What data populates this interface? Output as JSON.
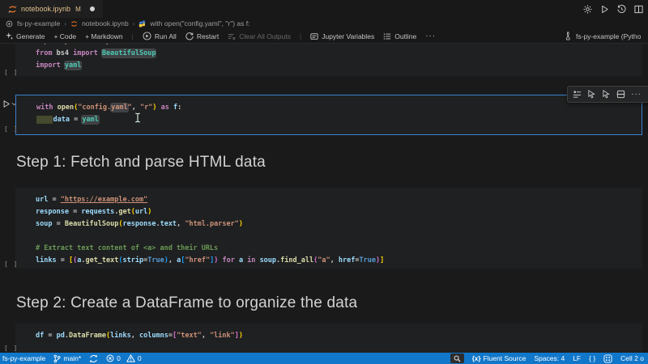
{
  "colors": {
    "status_bar": "#1177ca",
    "focus_border": "#3b82d0",
    "cell_background": "#1f2021",
    "editor_background": "#1a1a1a",
    "chrome_background": "#181818",
    "modified_tab": "#e2c08d",
    "jupyter_orange": "#f37626",
    "keyword": "#c586c0",
    "function": "#dcdcaa",
    "string": "#ce9178",
    "variable": "#9cdcfe",
    "constant": "#569cd6",
    "comment": "#6a9955",
    "class_name": "#4ec9b0",
    "bracket1": "#ffd700",
    "bracket2": "#da70d6",
    "bracket3": "#179fff"
  },
  "tab_bar": {
    "tab": {
      "icon": "jupyter-notebook-icon",
      "title": "notebook.ipynb",
      "git_badge": "M",
      "dirty_dot": true
    },
    "action_icons": [
      "settings-icon",
      "run-icon",
      "history-icon",
      "split-editor-icon"
    ]
  },
  "breadcrumb": {
    "root_icon": "workspace-icon",
    "items": [
      "fs-py-example",
      "notebook.ipynb"
    ],
    "file_icon": "jupyter-notebook-icon",
    "symbol_icon": "python-icon",
    "symbol": "with open(\"config.yaml\", \"r\") as f:",
    "separator": "›"
  },
  "notebook_toolbar": {
    "generate": "Generate",
    "add_code": "+ Code",
    "add_markdown": "+ Markdown",
    "run_all": "Run All",
    "restart": "Restart",
    "clear_all": "Clear All Outputs",
    "variables": "Jupyter Variables",
    "outline": "Outline",
    "more": "···",
    "separator": "|",
    "icons": [
      "sparkle-icon",
      "run-all-icon",
      "restart-icon",
      "clear-all-icon",
      "variables-icon",
      "outline-icon"
    ],
    "kernel": {
      "icon": "kernel-env-icon",
      "label": "fs-py-example (Pytho"
    }
  },
  "cell_toolbar": {
    "icons": [
      "run-by-line-icon",
      "run-above-icon",
      "run-below-icon",
      "split-cell-icon",
      "more-actions-icon"
    ]
  },
  "notebook": {
    "cells": [
      {
        "type": "code",
        "exec": "[ ]",
        "lines": [
          [
            [
              "kw",
              "import"
            ],
            [
              "txt",
              " pandas "
            ],
            [
              "kw",
              "as"
            ],
            [
              "txt",
              " pd"
            ]
          ],
          [
            [
              "kw",
              "from"
            ],
            [
              "txt",
              " bs4 "
            ],
            [
              "kw",
              "import"
            ],
            [
              "txt",
              " "
            ],
            [
              "cls hl",
              "BeautifulSoup"
            ]
          ],
          [
            [
              "kw",
              "import"
            ],
            [
              "txt",
              " "
            ],
            [
              "cls hl",
              "yaml"
            ]
          ]
        ]
      },
      {
        "type": "code",
        "focused": true,
        "exec": "[ ]",
        "lines": [
          [
            [
              "kw",
              "with"
            ],
            [
              "txt",
              " "
            ],
            [
              "fn",
              "open"
            ],
            [
              "b1",
              "("
            ],
            [
              "str",
              "\"config."
            ],
            [
              "str hl",
              "yaml"
            ],
            [
              "str",
              "\""
            ],
            [
              "txt",
              ", "
            ],
            [
              "str",
              "\"r\""
            ],
            [
              "b1",
              ")"
            ],
            [
              "txt",
              " "
            ],
            [
              "kw",
              "as"
            ],
            [
              "txt",
              " "
            ],
            [
              "var",
              "f"
            ],
            [
              "txt",
              ":"
            ]
          ],
          [
            [
              "sel",
              "    "
            ],
            [
              "var",
              "data"
            ],
            [
              "txt",
              " = "
            ],
            [
              "cls hl",
              "yaml"
            ]
          ]
        ]
      },
      {
        "type": "markdown",
        "text": "Step 1: Fetch and parse HTML data"
      },
      {
        "type": "code",
        "exec": "[ ]",
        "lines": [
          [
            [
              "var",
              "url"
            ],
            [
              "txt",
              " = "
            ],
            [
              "str link",
              "\"https://example.com\""
            ]
          ],
          [
            [
              "var",
              "response"
            ],
            [
              "txt",
              " = "
            ],
            [
              "var",
              "requests"
            ],
            [
              "txt",
              "."
            ],
            [
              "fn",
              "get"
            ],
            [
              "b1",
              "("
            ],
            [
              "var",
              "url"
            ],
            [
              "b1",
              ")"
            ]
          ],
          [
            [
              "var",
              "soup"
            ],
            [
              "txt",
              " = "
            ],
            [
              "fn",
              "BeautifulSoup"
            ],
            [
              "b1",
              "("
            ],
            [
              "var",
              "response"
            ],
            [
              "txt",
              "."
            ],
            [
              "var",
              "text"
            ],
            [
              "txt",
              ", "
            ],
            [
              "str",
              "\"html.parser\""
            ],
            [
              "b1",
              ")"
            ]
          ],
          [],
          [
            [
              "com",
              "# Extract text content of <a> and their URLs"
            ]
          ],
          [
            [
              "var",
              "links"
            ],
            [
              "txt",
              " = "
            ],
            [
              "b1",
              "["
            ],
            [
              "b2",
              "("
            ],
            [
              "var",
              "a"
            ],
            [
              "txt",
              "."
            ],
            [
              "fn",
              "get_text"
            ],
            [
              "b3",
              "("
            ],
            [
              "var",
              "strip"
            ],
            [
              "txt",
              "="
            ],
            [
              "const",
              "True"
            ],
            [
              "b3",
              ")"
            ],
            [
              "txt",
              ", "
            ],
            [
              "var",
              "a"
            ],
            [
              "b3",
              "["
            ],
            [
              "str",
              "\"href\""
            ],
            [
              "b3",
              "]"
            ],
            [
              "b2",
              ")"
            ],
            [
              "txt",
              " "
            ],
            [
              "kw",
              "for"
            ],
            [
              "txt",
              " "
            ],
            [
              "var",
              "a"
            ],
            [
              "txt",
              " "
            ],
            [
              "kw",
              "in"
            ],
            [
              "txt",
              " "
            ],
            [
              "var",
              "soup"
            ],
            [
              "txt",
              "."
            ],
            [
              "fn",
              "find_all"
            ],
            [
              "b2",
              "("
            ],
            [
              "str",
              "\"a\""
            ],
            [
              "txt",
              ", "
            ],
            [
              "var",
              "href"
            ],
            [
              "txt",
              "="
            ],
            [
              "const",
              "True"
            ],
            [
              "b2",
              ")"
            ],
            [
              "b1",
              "]"
            ]
          ]
        ]
      },
      {
        "type": "markdown",
        "text": "Step 2: Create a DataFrame to organize the data"
      },
      {
        "type": "code",
        "exec": "[ ]",
        "lines": [
          [
            [
              "var",
              "df"
            ],
            [
              "txt",
              " = "
            ],
            [
              "var",
              "pd"
            ],
            [
              "txt",
              "."
            ],
            [
              "fn",
              "DataFrame"
            ],
            [
              "b1",
              "("
            ],
            [
              "var",
              "links"
            ],
            [
              "txt",
              ", "
            ],
            [
              "var",
              "columns"
            ],
            [
              "txt",
              "="
            ],
            [
              "b2",
              "["
            ],
            [
              "str",
              "\"text\""
            ],
            [
              "txt",
              ", "
            ],
            [
              "str",
              "\"link\""
            ],
            [
              "b2",
              "]"
            ],
            [
              "b1",
              ")"
            ]
          ]
        ]
      }
    ]
  },
  "status_bar": {
    "project": "fs-py-example",
    "branch": {
      "icon": "git-branch-icon",
      "label": "main*"
    },
    "sync_icon": "sync-icon",
    "errors": {
      "icon": "error-icon",
      "count": "0"
    },
    "warnings": {
      "icon": "warning-icon",
      "count": "0"
    },
    "zoom_icon": "magnifier-icon",
    "fluent": {
      "icon": "fluent-braces-icon",
      "label": "Fluent Source"
    },
    "spaces": "Spaces: 4",
    "eol": "LF",
    "language_braces": "{ }",
    "extension_icon": "extension-grid-icon",
    "cell_indicator": "Cell 2 o"
  }
}
